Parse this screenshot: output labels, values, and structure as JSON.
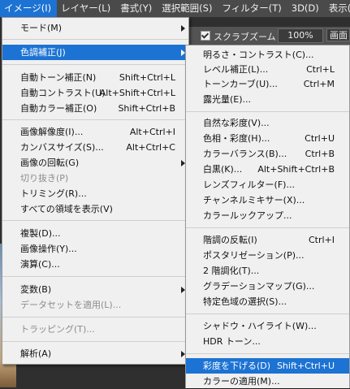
{
  "menubar": {
    "items": [
      "イメージ(I)",
      "レイヤー(L)",
      "書式(Y)",
      "選択範囲(S)",
      "フィルター(T)",
      "3D(D)",
      "表示(V)"
    ]
  },
  "options_bar": {
    "scrubby_zoom_label": "スクラブズーム",
    "zoom_value": "100%",
    "extra_label": "画面"
  },
  "image_menu": {
    "items": [
      {
        "label": "モード(M)",
        "shortcut": "",
        "submenu": true,
        "disabled": false
      },
      {
        "label": "色調補正(J)",
        "shortcut": "",
        "submenu": true,
        "disabled": false,
        "highlighted": true
      },
      {
        "label": "自動トーン補正(N)",
        "shortcut": "Shift+Ctrl+L"
      },
      {
        "label": "自動コントラスト(U)",
        "shortcut": "Alt+Shift+Ctrl+L"
      },
      {
        "label": "自動カラー補正(O)",
        "shortcut": "Shift+Ctrl+B"
      },
      {
        "label": "画像解像度(I)...",
        "shortcut": "Alt+Ctrl+I"
      },
      {
        "label": "カンバスサイズ(S)...",
        "shortcut": "Alt+Ctrl+C"
      },
      {
        "label": "画像の回転(G)",
        "shortcut": "",
        "submenu": true
      },
      {
        "label": "切り抜き(P)",
        "shortcut": "",
        "disabled": true
      },
      {
        "label": "トリミング(R)...",
        "shortcut": ""
      },
      {
        "label": "すべての領域を表示(V)",
        "shortcut": ""
      },
      {
        "label": "複製(D)...",
        "shortcut": ""
      },
      {
        "label": "画像操作(Y)...",
        "shortcut": ""
      },
      {
        "label": "演算(C)...",
        "shortcut": ""
      },
      {
        "label": "変数(B)",
        "shortcut": "",
        "submenu": true
      },
      {
        "label": "データセットを適用(L)...",
        "shortcut": "",
        "disabled": true
      },
      {
        "label": "トラッピング(T)...",
        "shortcut": "",
        "disabled": true
      },
      {
        "label": "解析(A)",
        "shortcut": "",
        "submenu": true
      }
    ]
  },
  "adjustments_submenu": {
    "items": [
      {
        "label": "明るさ・コントラスト(C)...",
        "shortcut": ""
      },
      {
        "label": "レベル補正(L)...",
        "shortcut": "Ctrl+L"
      },
      {
        "label": "トーンカーブ(U)...",
        "shortcut": "Ctrl+M"
      },
      {
        "label": "露光量(E)...",
        "shortcut": ""
      },
      {
        "label": "自然な彩度(V)...",
        "shortcut": ""
      },
      {
        "label": "色相・彩度(H)...",
        "shortcut": "Ctrl+U"
      },
      {
        "label": "カラーバランス(B)...",
        "shortcut": "Ctrl+B"
      },
      {
        "label": "白黒(K)...",
        "shortcut": "Alt+Shift+Ctrl+B"
      },
      {
        "label": "レンズフィルター(F)...",
        "shortcut": ""
      },
      {
        "label": "チャンネルミキサー(X)...",
        "shortcut": ""
      },
      {
        "label": "カラールックアップ...",
        "shortcut": ""
      },
      {
        "label": "階調の反転(I)",
        "shortcut": "Ctrl+I"
      },
      {
        "label": "ポスタリゼーション(P)...",
        "shortcut": ""
      },
      {
        "label": "2 階調化(T)...",
        "shortcut": ""
      },
      {
        "label": "グラデーションマップ(G)...",
        "shortcut": ""
      },
      {
        "label": "特定色域の選択(S)...",
        "shortcut": ""
      },
      {
        "label": "シャドウ・ハイライト(W)...",
        "shortcut": ""
      },
      {
        "label": "HDR トーン...",
        "shortcut": ""
      },
      {
        "label": "彩度を下げる(D)",
        "shortcut": "Shift+Ctrl+U",
        "highlighted": true
      },
      {
        "label": "カラーの適用(M)...",
        "shortcut": ""
      }
    ]
  },
  "colors": {
    "highlight": "#1c73d3",
    "menu_bg": "#f0f0f0",
    "menubar_bg": "#4a4a4a"
  }
}
